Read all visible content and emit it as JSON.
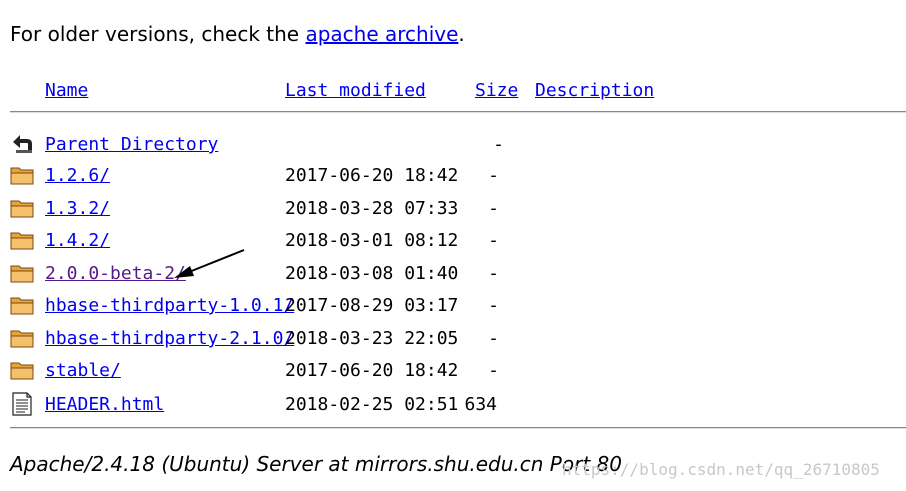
{
  "intro": {
    "text": "For older versions, check the ",
    "link": "apache archive",
    "end": "."
  },
  "columns": {
    "name": "Name",
    "last_modified": "Last modified",
    "size": "Size",
    "description": "Description"
  },
  "rows": [
    {
      "icon": "back-icon",
      "name": "Parent Directory",
      "date": "",
      "size": "-"
    },
    {
      "icon": "folder-icon",
      "name": "1.2.6/",
      "date": "2017-06-20 18:42",
      "size": "-"
    },
    {
      "icon": "folder-icon",
      "name": "1.3.2/",
      "date": "2018-03-28 07:33",
      "size": "-"
    },
    {
      "icon": "folder-icon",
      "name": "1.4.2/",
      "date": "2018-03-01 08:12",
      "size": "-"
    },
    {
      "icon": "folder-icon",
      "name": "2.0.0-beta-2/",
      "date": "2018-03-08 01:40",
      "size": "-",
      "visited": true
    },
    {
      "icon": "folder-icon",
      "name": "hbase-thirdparty-1.0.1/",
      "date": "2017-08-29 03:17",
      "size": "-"
    },
    {
      "icon": "folder-icon",
      "name": "hbase-thirdparty-2.1.0/",
      "date": "2018-03-23 22:05",
      "size": "-"
    },
    {
      "icon": "folder-icon",
      "name": "stable/",
      "date": "2017-06-20 18:42",
      "size": "-"
    },
    {
      "icon": "text-file-icon",
      "name": "HEADER.html",
      "date": "2018-02-25 02:51",
      "size": "634"
    }
  ],
  "footer": "Apache/2.4.18 (Ubuntu) Server at mirrors.shu.edu.cn Port 80",
  "watermark": "https://blog.csdn.net/qq_26710805"
}
